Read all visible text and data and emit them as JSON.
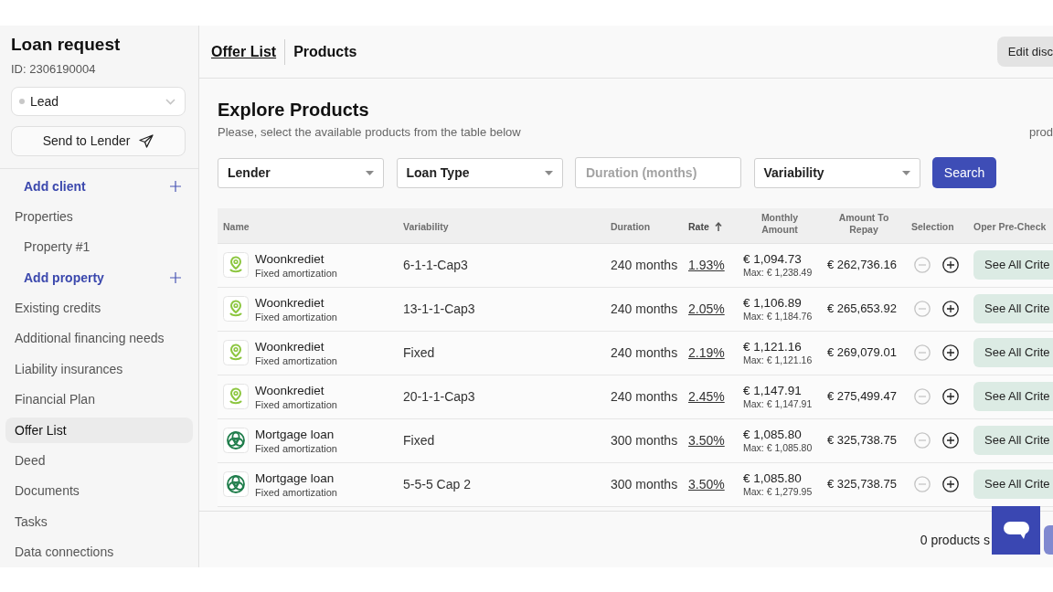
{
  "sidebar": {
    "title": "Loan request",
    "request_id": "ID: 2306190004",
    "status_select": {
      "value": "Lead"
    },
    "send_button": "Send to Lender",
    "items": [
      {
        "label": "Add client",
        "kind": "add",
        "selected": false
      },
      {
        "label": "Properties",
        "kind": "link",
        "selected": false,
        "children": [
          {
            "label": "Property #1",
            "kind": "link",
            "selected": false
          },
          {
            "label": "Add property",
            "kind": "add",
            "selected": false
          }
        ]
      },
      {
        "label": "Existing credits",
        "kind": "link",
        "selected": false
      },
      {
        "label": "Additional financing needs",
        "kind": "link",
        "selected": false
      },
      {
        "label": "Liability insurances",
        "kind": "link",
        "selected": false
      },
      {
        "label": "Financial Plan",
        "kind": "link",
        "selected": false
      },
      {
        "label": "Offer List",
        "kind": "link",
        "selected": true
      },
      {
        "label": "Deed",
        "kind": "link",
        "selected": false
      },
      {
        "label": "Documents",
        "kind": "link",
        "selected": false
      },
      {
        "label": "Tasks",
        "kind": "link",
        "selected": false
      },
      {
        "label": "Data connections",
        "kind": "link",
        "selected": false
      }
    ]
  },
  "header": {
    "breadcrumb": [
      {
        "label": "Offer List",
        "kind": "link"
      },
      {
        "label": "Products",
        "kind": "current"
      }
    ],
    "edit_button": "Edit disc"
  },
  "explore": {
    "title": "Explore Products",
    "subtitle": "Please, select the available products from the table below",
    "side_note": "prod",
    "filters": [
      {
        "kind": "select",
        "label": "Lender"
      },
      {
        "kind": "select",
        "label": "Loan Type"
      },
      {
        "kind": "input",
        "placeholder": "Duration (months)"
      },
      {
        "kind": "select",
        "label": "Variability"
      }
    ],
    "search_button": "Search"
  },
  "table": {
    "columns": [
      {
        "label": "Name",
        "sorted": false
      },
      {
        "label": "Variability",
        "sorted": false
      },
      {
        "label": "Duration",
        "sorted": false
      },
      {
        "label": "Rate",
        "sorted": true
      },
      {
        "label": "Monthly Amount",
        "sorted": false
      },
      {
        "label": "Amount To Repay",
        "sorted": false
      },
      {
        "label": "Selection",
        "sorted": false
      },
      {
        "label": "Oper Pre-Check",
        "sorted": false
      }
    ],
    "rows": [
      {
        "kind": "pin",
        "name": "Woonkrediet",
        "type": "Fixed amortization",
        "variability": "6-1-1-Cap3",
        "duration": "240 months",
        "rate": "1.93%",
        "monthly": "€ 1,094.73",
        "monthly_max": "Max: € 1,238.49",
        "amount_to_repay": "€ 262,736.16",
        "remove_disabled": true,
        "action": "See All Crite"
      },
      {
        "kind": "pin",
        "name": "Woonkrediet",
        "type": "Fixed amortization",
        "variability": "13-1-1-Cap3",
        "duration": "240 months",
        "rate": "2.05%",
        "monthly": "€ 1,106.89",
        "monthly_max": "Max: € 1,184.76",
        "amount_to_repay": "€ 265,653.92",
        "remove_disabled": true,
        "action": "See All Crite"
      },
      {
        "kind": "pin",
        "name": "Woonkrediet",
        "type": "Fixed amortization",
        "variability": "Fixed",
        "duration": "240 months",
        "rate": "2.19%",
        "monthly": "€ 1,121.16",
        "monthly_max": "Max: € 1,121.16",
        "amount_to_repay": "€ 269,079.01",
        "remove_disabled": true,
        "action": "See All Crite"
      },
      {
        "kind": "pin",
        "name": "Woonkrediet",
        "type": "Fixed amortization",
        "variability": "20-1-1-Cap3",
        "duration": "240 months",
        "rate": "2.45%",
        "monthly": "€ 1,147.91",
        "monthly_max": "Max: € 1,147.91",
        "amount_to_repay": "€ 275,499.47",
        "remove_disabled": true,
        "action": "See All Crite"
      },
      {
        "kind": "knot",
        "name": "Mortgage loan",
        "type": "Fixed amortization",
        "variability": "Fixed",
        "duration": "300 months",
        "rate": "3.50%",
        "monthly": "€ 1,085.80",
        "monthly_max": "Max: € 1,085.80",
        "amount_to_repay": "€ 325,738.75",
        "remove_disabled": true,
        "action": "See All Crite"
      },
      {
        "kind": "knot",
        "name": "Mortgage loan",
        "type": "Fixed amortization",
        "variability": "5-5-5 Cap 2",
        "duration": "300 months",
        "rate": "3.50%",
        "monthly": "€ 1,085.80",
        "monthly_max": "Max: € 1,279.95",
        "amount_to_repay": "€ 325,738.75",
        "remove_disabled": true,
        "action": "See All Crite"
      }
    ]
  },
  "footer": {
    "selected_count": "0 products s"
  }
}
